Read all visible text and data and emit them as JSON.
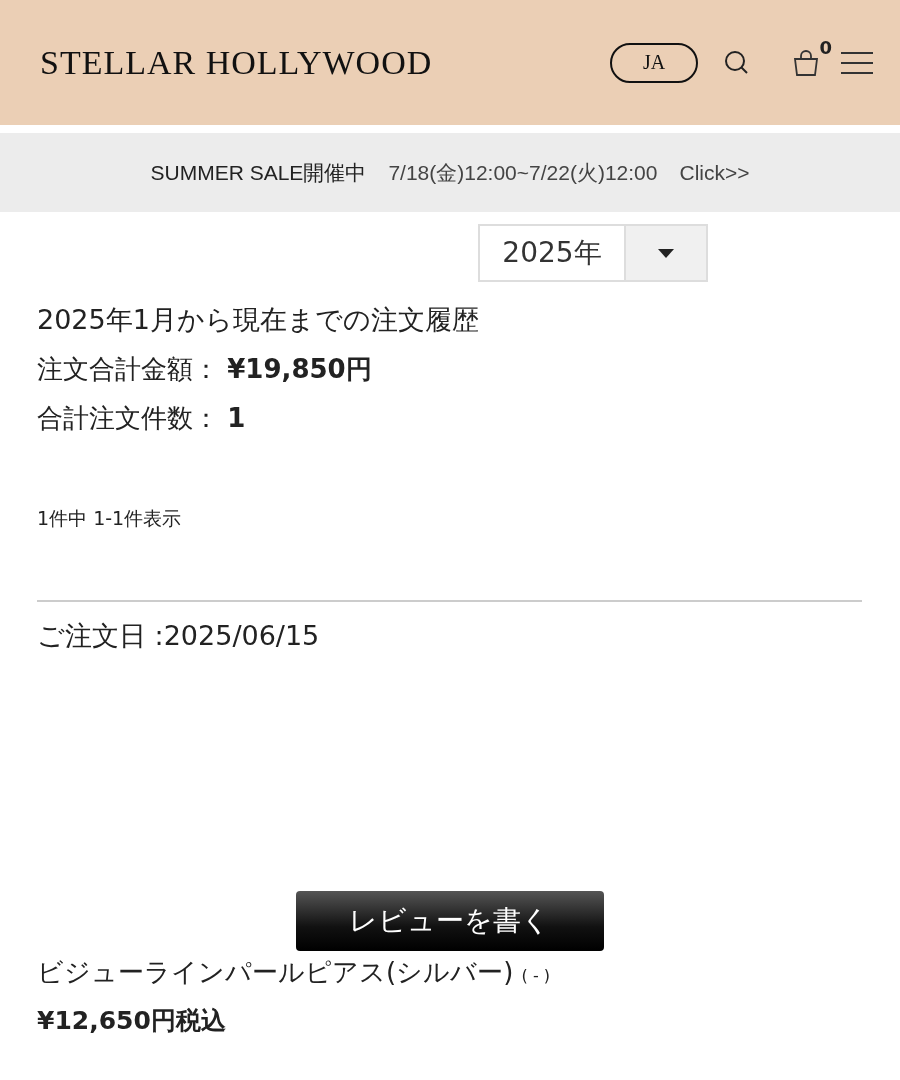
{
  "header": {
    "logo": "STELLAR HOLLYWOOD",
    "language": "JA",
    "cart_count": "0"
  },
  "banner": {
    "title": "SUMMER SALE開催中",
    "period": "7/18(金)12:00~7/22(火)12:00",
    "link": "Click>>"
  },
  "year_select": {
    "value": "2025年"
  },
  "summary": {
    "heading": "2025年1月から現在までの注文履歴",
    "total_label": "注文合計金額：",
    "total_value": "¥19,850円",
    "count_label": "合計注文件数：",
    "count_value": "1"
  },
  "pagination": "1件中 1-1件表示",
  "order": {
    "date": "ご注文日 :2025/06/15",
    "review_button": "レビューを書く",
    "product": "ビジューラインパールピアス(シルバー)",
    "variant": "( - )",
    "price": "¥12,650円税込"
  }
}
